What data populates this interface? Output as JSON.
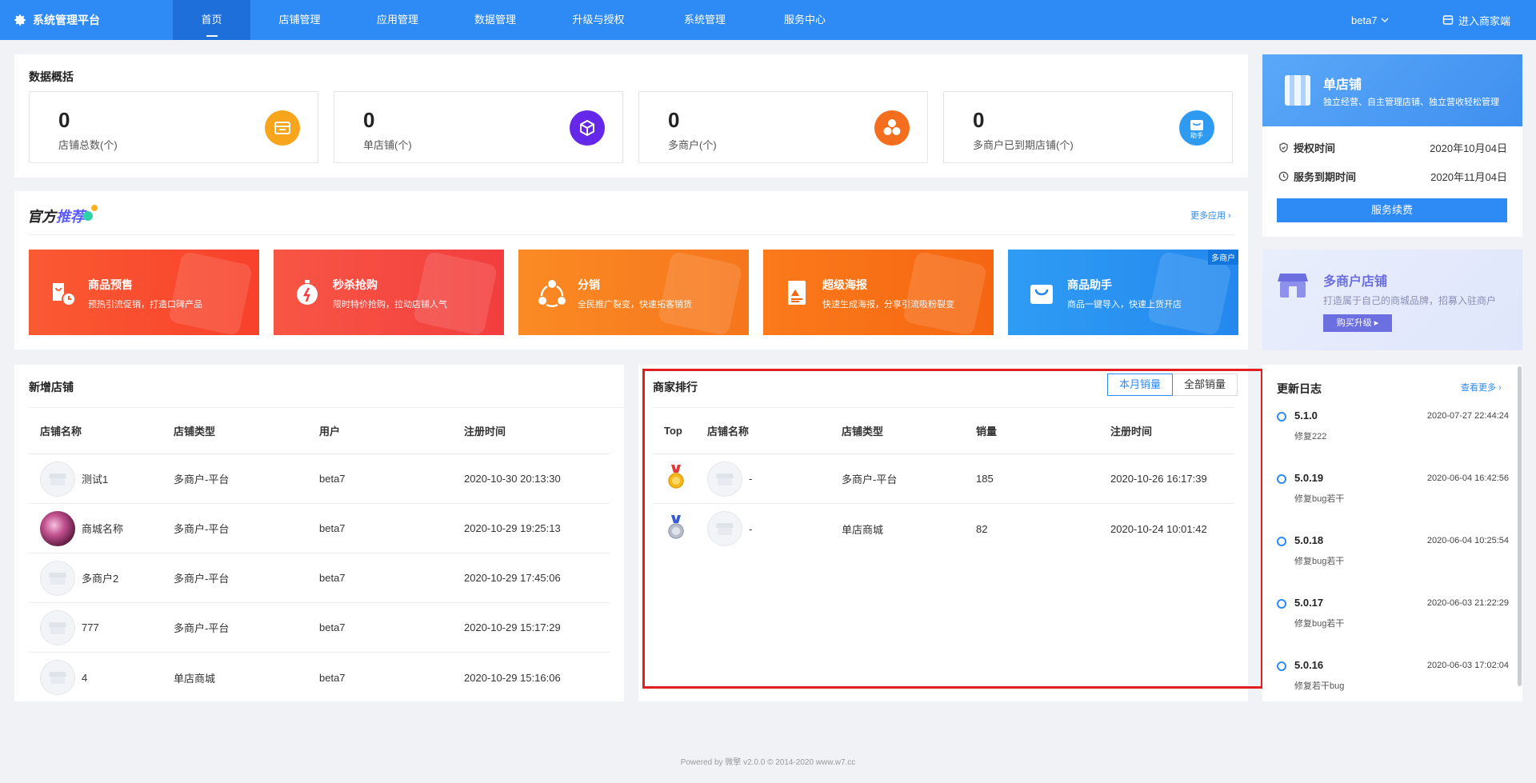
{
  "nav": {
    "brand": "系统管理平台",
    "items": [
      "首页",
      "店铺管理",
      "应用管理",
      "数据管理",
      "升级与授权",
      "系统管理",
      "服务中心"
    ],
    "user": "beta7",
    "enter": "进入商家端"
  },
  "overview": {
    "title": "数据概括",
    "cards": [
      {
        "value": "0",
        "label": "店铺总数(个)",
        "color": "#f7a51c",
        "icon": "store-icon"
      },
      {
        "value": "0",
        "label": "单店铺(个)",
        "color": "#6528e8",
        "icon": "cube-icon"
      },
      {
        "value": "0",
        "label": "多商户(个)",
        "color": "#f56e1e",
        "icon": "hexagons-icon"
      },
      {
        "value": "0",
        "label": "多商户已到期店铺(个)",
        "color": "#2e9bf0",
        "icon": "bag-icon",
        "icon_text": "助手"
      }
    ]
  },
  "recommend": {
    "title_a": "官方",
    "title_b": "推荐",
    "more": "更多应用",
    "cards": [
      {
        "title": "商品预售",
        "desc": "预热引流促销，打造口碑产品",
        "color_from": "#fa5a32",
        "color_to": "#f8412c",
        "icon": "presale-icon"
      },
      {
        "title": "秒杀抢购",
        "desc": "限时特价抢购，拉动店铺人气",
        "color_from": "#f85645",
        "color_to": "#f23e3e",
        "icon": "stopwatch-icon"
      },
      {
        "title": "分销",
        "desc": "全民推广裂变，快速拓客销货",
        "color_from": "#fb8a24",
        "color_to": "#f6761c",
        "icon": "share-icon"
      },
      {
        "title": "超级海报",
        "desc": "快速生成海报，分享引流吸粉裂变",
        "color_from": "#fb7a1a",
        "color_to": "#f56612",
        "icon": "poster-icon"
      },
      {
        "title": "商品助手",
        "desc": "商品一键导入，快速上货开店",
        "color_from": "#2f9cf4",
        "color_to": "#2488ee",
        "icon": "bag-icon",
        "badge": "多商户"
      }
    ]
  },
  "new_shops": {
    "title": "新增店铺",
    "columns": [
      "店铺名称",
      "店铺类型",
      "用户",
      "注册时间"
    ],
    "rows": [
      {
        "name": "测试1",
        "type": "多商户-平台",
        "user": "beta7",
        "time": "2020-10-30 20:13:30",
        "photo": false
      },
      {
        "name": "商城名称",
        "type": "多商户-平台",
        "user": "beta7",
        "time": "2020-10-29 19:25:13",
        "photo": true
      },
      {
        "name": "多商户2",
        "type": "多商户-平台",
        "user": "beta7",
        "time": "2020-10-29 17:45:06",
        "photo": false
      },
      {
        "name": "777",
        "type": "多商户-平台",
        "user": "beta7",
        "time": "2020-10-29 15:17:29",
        "photo": false
      },
      {
        "name": "4",
        "type": "单店商城",
        "user": "beta7",
        "time": "2020-10-29 15:16:06",
        "photo": false
      }
    ]
  },
  "ranking": {
    "title": "商家排行",
    "tabs": [
      "本月销量",
      "全部销量"
    ],
    "columns": [
      "Top",
      "店铺名称",
      "店铺类型",
      "销量",
      "注册时间"
    ],
    "rows": [
      {
        "medal": "gold",
        "name": "-",
        "type": "多商户-平台",
        "sales": "185",
        "time": "2020-10-26 16:17:39"
      },
      {
        "medal": "silver",
        "name": "-",
        "type": "单店商城",
        "sales": "82",
        "time": "2020-10-24 10:01:42"
      }
    ]
  },
  "license": {
    "title": "单店铺",
    "desc": "独立经营、自主管理店铺、独立营收轻松管理",
    "auth_label": "授权时间",
    "auth_value": "2020年10月04日",
    "expire_label": "服务到期时间",
    "expire_value": "2020年11月04日",
    "renew": "服务续费"
  },
  "multi": {
    "title": "多商户店铺",
    "desc": "打造属于自己的商城品牌，招募入驻商户",
    "button": "购买升级 ▸"
  },
  "changelog": {
    "title": "更新日志",
    "more": "查看更多",
    "items": [
      {
        "version": "5.1.0",
        "time": "2020-07-27 22:44:24",
        "desc": "修复222"
      },
      {
        "version": "5.0.19",
        "time": "2020-06-04 16:42:56",
        "desc": "修复bug若干"
      },
      {
        "version": "5.0.18",
        "time": "2020-06-04 10:25:54",
        "desc": "修复bug若干"
      },
      {
        "version": "5.0.17",
        "time": "2020-06-03 21:22:29",
        "desc": "修复bug若干"
      },
      {
        "version": "5.0.16",
        "time": "2020-06-03 17:02:04",
        "desc": "修复若干bug"
      }
    ]
  },
  "footer": "Powered by 微擎 v2.0.0 © 2014-2020 www.w7.cc"
}
